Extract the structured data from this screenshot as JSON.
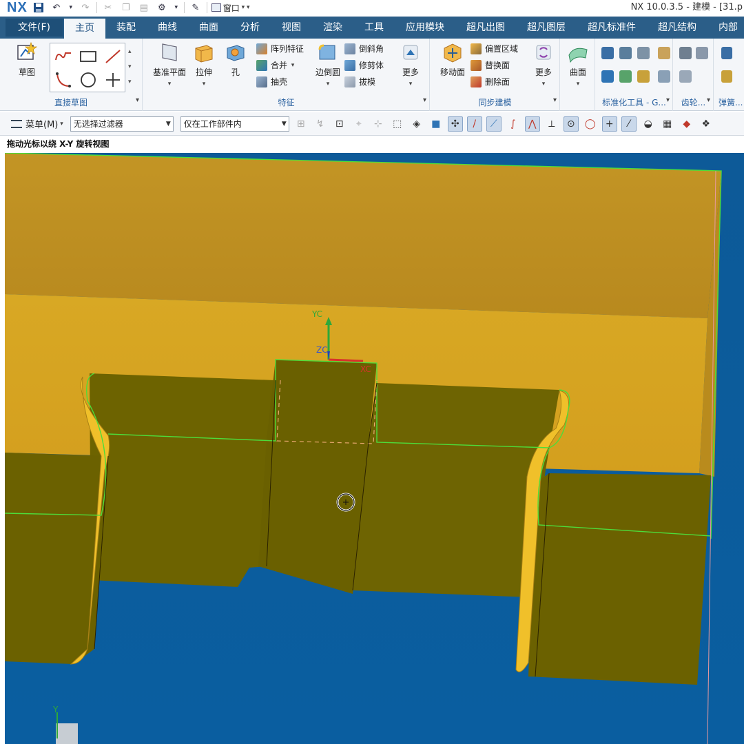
{
  "app": {
    "logo": "NX",
    "window_title": "NX 10.0.3.5 - 建模 - [31.p",
    "window_menu": "窗口"
  },
  "tabs": [
    "文件(F)",
    "主页",
    "装配",
    "曲线",
    "曲面",
    "分析",
    "视图",
    "渲染",
    "工具",
    "应用模块",
    "超凡出图",
    "超凡图层",
    "超凡标准件",
    "超凡结构",
    "内部"
  ],
  "active_tab": "主页",
  "ribbon": {
    "sketch": {
      "big_label": "草图",
      "group_label": "直接草图"
    },
    "feature": {
      "group_label": "特征",
      "datum_plane": "基准平面",
      "extrude": "拉伸",
      "hole": "孔",
      "pattern": "阵列特征",
      "unite": "合并",
      "shell": "抽壳",
      "edge_blend": "边倒圆",
      "chamfer": "倒斜角",
      "trim_body": "修剪体",
      "draft": "拔模",
      "more": "更多"
    },
    "sync": {
      "group_label": "同步建模",
      "move_face": "移动面",
      "offset_region": "偏置区域",
      "replace_face": "替换面",
      "delete_face": "删除面",
      "more": "更多"
    },
    "surface": {
      "label": "曲面"
    },
    "standard": {
      "group_label": "标准化工具 - G..."
    },
    "gear": {
      "group_label": "齿轮..."
    },
    "spring": {
      "group_label": "弹簧..."
    }
  },
  "selection_bar": {
    "menu": "菜单(M)",
    "filter": "无选择过滤器",
    "scope": "仅在工作部件内"
  },
  "hint": "拖动光标以绕 X-Y 旋转视图",
  "wcs": {
    "x": "XC",
    "y": "YC",
    "z": "ZC"
  },
  "triad": {
    "y": "Y"
  }
}
